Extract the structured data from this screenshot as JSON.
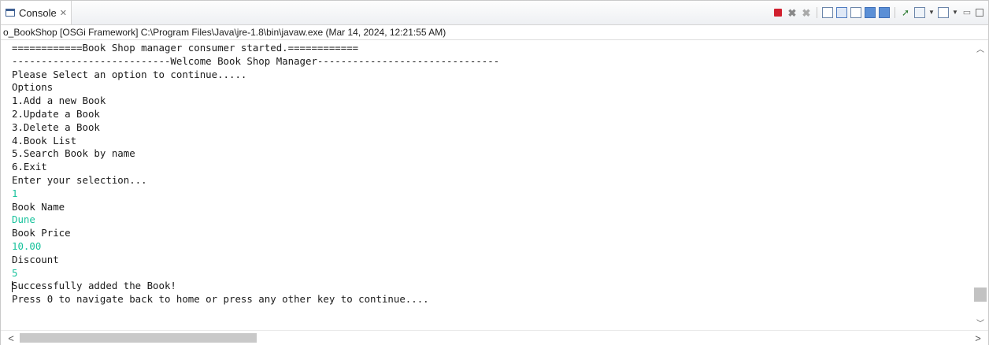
{
  "tab": {
    "label": "Console",
    "close": "✕",
    "icon": "console-icon"
  },
  "toolbar": {
    "icons": [
      "terminate-icon",
      "remove-launch-icon",
      "remove-all-terminated-icon",
      "clear-console-icon",
      "scroll-lock-icon",
      "word-wrap-icon",
      "show-on-stdout-icon",
      "show-on-stderr-icon",
      "pin-console-icon",
      "display-selected-console-icon",
      "open-console-icon",
      "minimize-icon",
      "maximize-icon"
    ]
  },
  "process": {
    "label": "o_BookShop [OSGi Framework] C:\\Program Files\\Java\\jre-1.8\\bin\\javaw.exe  (Mar 14, 2024, 12:21:55 AM)"
  },
  "console": {
    "lines": [
      {
        "text": "============Book Shop manager consumer started.============",
        "type": "output"
      },
      {
        "text": "---------------------------Welcome Book Shop Manager-------------------------------",
        "type": "output"
      },
      {
        "text": "Please Select an option to continue.....",
        "type": "output"
      },
      {
        "text": "Options",
        "type": "output"
      },
      {
        "text": "1.Add a new Book",
        "type": "output"
      },
      {
        "text": "2.Update a Book",
        "type": "output"
      },
      {
        "text": "3.Delete a Book",
        "type": "output"
      },
      {
        "text": "4.Book List",
        "type": "output"
      },
      {
        "text": "5.Search Book by name",
        "type": "output"
      },
      {
        "text": "6.Exit",
        "type": "output"
      },
      {
        "text": "Enter your selection...",
        "type": "output"
      },
      {
        "text": "1",
        "type": "input"
      },
      {
        "text": "Book Name",
        "type": "output"
      },
      {
        "text": "Dune",
        "type": "input"
      },
      {
        "text": "Book Price",
        "type": "output"
      },
      {
        "text": "10.00",
        "type": "input"
      },
      {
        "text": "Discount",
        "type": "output"
      },
      {
        "text": "5",
        "type": "input"
      },
      {
        "text": "Successfully added the Book!",
        "type": "output"
      },
      {
        "text": "Press 0 to navigate back to home or press any other key to continue....",
        "type": "output"
      }
    ]
  },
  "scroll": {
    "vertical_position": 0.95,
    "horizontal_position": 0.0,
    "horizontal_visible": 0.25
  },
  "colors": {
    "stdout": "#1a1a1a",
    "stdin": "#18c29c",
    "terminate": "#d11f2e"
  }
}
